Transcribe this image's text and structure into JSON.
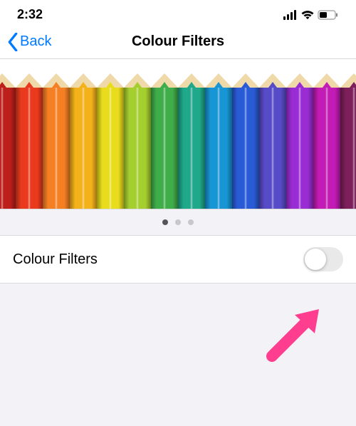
{
  "status": {
    "time": "2:32"
  },
  "nav": {
    "back_label": "Back",
    "title": "Colour Filters"
  },
  "pencils": [
    "#bd1f1a",
    "#ea3a1e",
    "#f58023",
    "#f4b21a",
    "#e8dc1c",
    "#a5ce2f",
    "#3fae4a",
    "#1fa88a",
    "#1895d5",
    "#2a5bd7",
    "#584bc8",
    "#9a2cd3",
    "#c31bb5",
    "#7d1f5a"
  ],
  "dots": {
    "count": 3,
    "active": 0
  },
  "row": {
    "label": "Colour Filters",
    "toggle_on": false
  }
}
